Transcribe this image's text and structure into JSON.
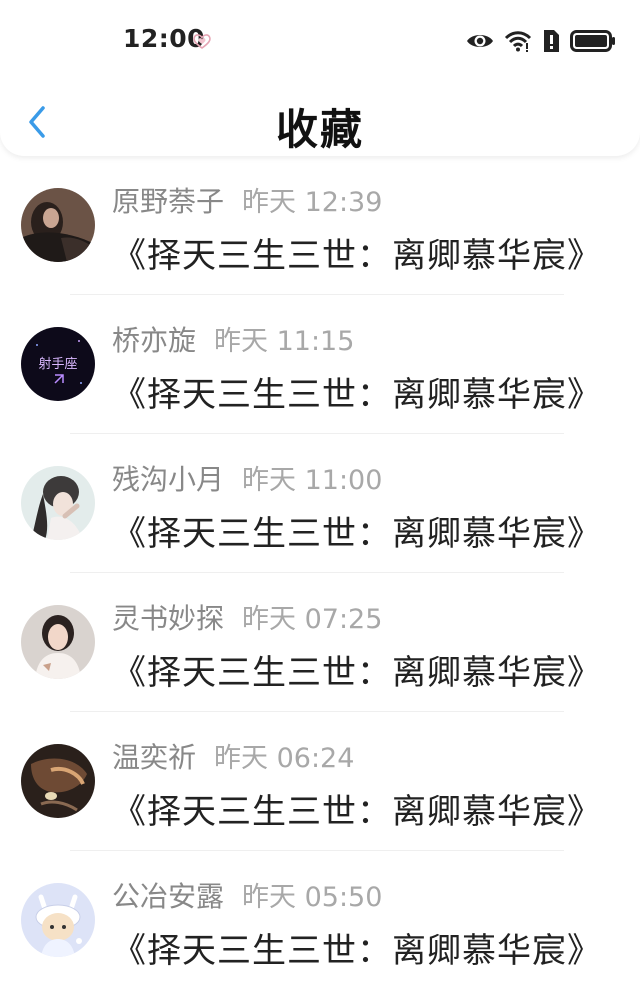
{
  "status_bar": {
    "time": "12:00"
  },
  "header": {
    "title": "收藏"
  },
  "items": [
    {
      "user": "原野萘子",
      "time": "昨天 12:39",
      "title": "《择天三生三世：离卿慕华宸》"
    },
    {
      "user": "桥亦旋",
      "time": "昨天 11:15",
      "title": "《择天三生三世：离卿慕华宸》",
      "avatar_text": "射手座"
    },
    {
      "user": "残沟小月",
      "time": "昨天 11:00",
      "title": "《择天三生三世：离卿慕华宸》"
    },
    {
      "user": "灵书妙探",
      "time": "昨天 07:25",
      "title": "《择天三生三世：离卿慕华宸》"
    },
    {
      "user": "温奕祈",
      "time": "昨天 06:24",
      "title": "《择天三生三世：离卿慕华宸》"
    },
    {
      "user": "公冶安露",
      "time": "昨天 05:50",
      "title": "《择天三生三世：离卿慕华宸》"
    }
  ],
  "colors": {
    "accent": "#3a9be8",
    "name_text": "#888888",
    "title_text": "#222222"
  }
}
